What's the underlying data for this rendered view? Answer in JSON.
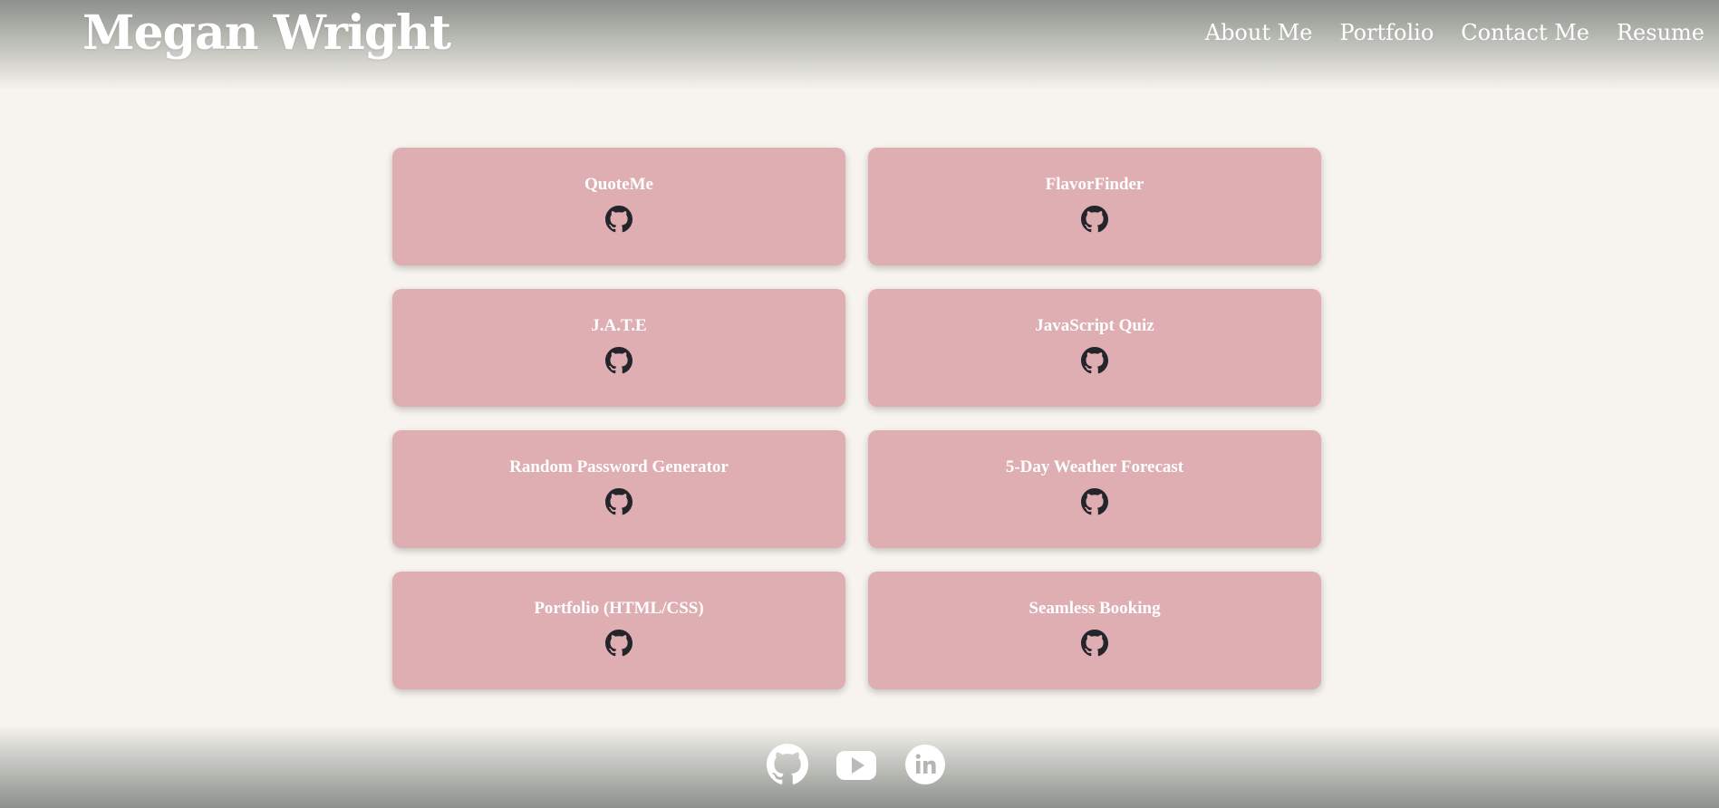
{
  "header": {
    "title": "Megan Wright",
    "nav": [
      "About Me",
      "Portfolio",
      "Contact Me",
      "Resume"
    ]
  },
  "projects": [
    {
      "title": "QuoteMe",
      "icon": "github-icon"
    },
    {
      "title": "FlavorFinder",
      "icon": "github-icon"
    },
    {
      "title": "J.A.T.E",
      "icon": "github-icon"
    },
    {
      "title": "JavaScript Quiz",
      "icon": "github-icon"
    },
    {
      "title": "Random Password Generator",
      "icon": "github-icon"
    },
    {
      "title": "5-Day Weather Forecast",
      "icon": "github-icon"
    },
    {
      "title": "Portfolio (HTML/CSS)",
      "icon": "github-icon"
    },
    {
      "title": "Seamless Booking",
      "icon": "github-icon"
    }
  ],
  "footer": {
    "social": [
      "github-icon",
      "youtube-icon",
      "linkedin-icon"
    ]
  },
  "colors": {
    "background": "#f7f4ef",
    "card": "#dfaeb2",
    "header_gradient": "#8d918b",
    "icon_dark": "#23252b",
    "text": "#ffffff"
  }
}
